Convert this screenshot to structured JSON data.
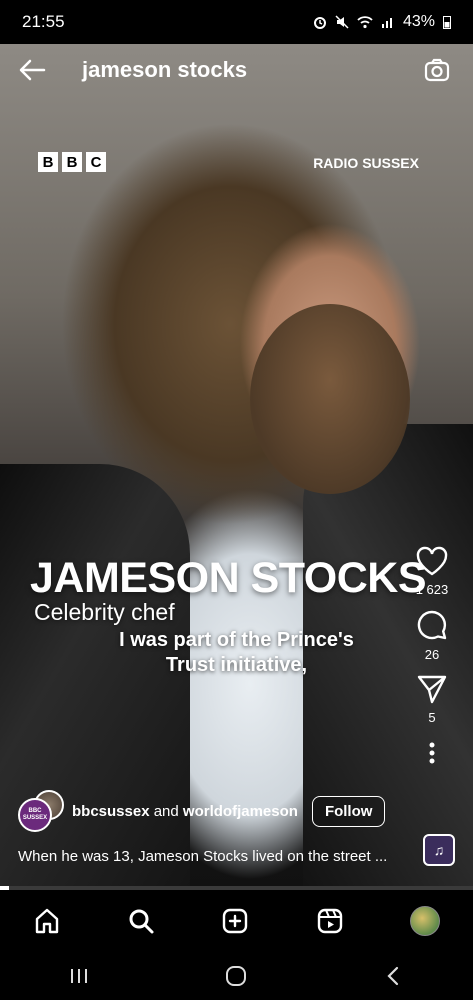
{
  "status_bar": {
    "time": "21:55",
    "battery": "43%"
  },
  "header": {
    "title": "jameson stocks"
  },
  "video": {
    "logo": "BBC",
    "station": "RADIO SUSSEX",
    "name_caption": "JAMESON STOCKS",
    "role_caption": "Celebrity chef",
    "subtitle_line1": "I was part of the Prince's",
    "subtitle_line2": "Trust initiative,"
  },
  "actions": {
    "likes": "1 623",
    "comments": "26",
    "shares": "5"
  },
  "post": {
    "author_1": "bbcsussex",
    "joiner": "and",
    "author_2": "worldofjameson",
    "follow_label": "Follow",
    "avatar_text": "BBC SUSSEX",
    "caption": "When he was 13, Jameson Stocks lived on the street ..."
  },
  "progress": 0.02,
  "icons": [
    "back-arrow-icon",
    "camera-icon",
    "heart-icon",
    "comment-icon",
    "send-icon",
    "more-icon",
    "music-icon",
    "home-icon",
    "search-icon",
    "create-icon",
    "reels-icon",
    "profile-avatar"
  ]
}
